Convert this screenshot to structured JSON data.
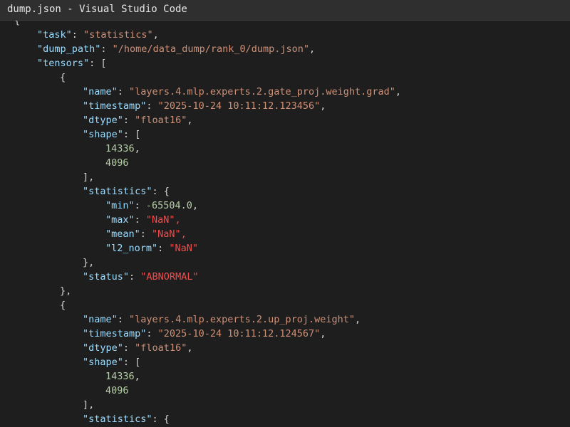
{
  "window": {
    "title": "dump.json - Visual Studio Code"
  },
  "colors": {
    "key": "#9cdcfe",
    "string": "#ce9178",
    "number": "#b5cea8",
    "error": "#f14c4c",
    "punctuation": "#d4d4d4",
    "background": "#1e1e1e"
  },
  "editor": {
    "lines": [
      {
        "indent": 1,
        "tokens": [
          {
            "t": "p",
            "v": "{"
          }
        ]
      },
      {
        "indent": 2,
        "tokens": [
          {
            "t": "k",
            "v": "\"task\""
          },
          {
            "t": "p",
            "v": ": "
          },
          {
            "t": "s",
            "v": "\"statistics\""
          },
          {
            "t": "p",
            "v": ","
          }
        ]
      },
      {
        "indent": 2,
        "tokens": [
          {
            "t": "k",
            "v": "\"dump_path\""
          },
          {
            "t": "p",
            "v": ": "
          },
          {
            "t": "s",
            "v": "\"/home/data_dump/rank_0/dump.json\""
          },
          {
            "t": "p",
            "v": ","
          }
        ]
      },
      {
        "indent": 2,
        "tokens": [
          {
            "t": "k",
            "v": "\"tensors\""
          },
          {
            "t": "p",
            "v": ": ["
          }
        ]
      },
      {
        "indent": 3,
        "tokens": [
          {
            "t": "p",
            "v": "{"
          }
        ]
      },
      {
        "indent": 4,
        "tokens": [
          {
            "t": "k",
            "v": "\"name\""
          },
          {
            "t": "p",
            "v": ": "
          },
          {
            "t": "s",
            "v": "\"layers.4.mlp.experts.2.gate_proj.weight.grad\""
          },
          {
            "t": "p",
            "v": ","
          }
        ]
      },
      {
        "indent": 4,
        "tokens": [
          {
            "t": "k",
            "v": "\"timestamp\""
          },
          {
            "t": "p",
            "v": ": "
          },
          {
            "t": "s",
            "v": "\"2025-10-24 10:11:12.123456\""
          },
          {
            "t": "p",
            "v": ","
          }
        ]
      },
      {
        "indent": 4,
        "tokens": [
          {
            "t": "k",
            "v": "\"dtype\""
          },
          {
            "t": "p",
            "v": ": "
          },
          {
            "t": "s",
            "v": "\"float16\""
          },
          {
            "t": "p",
            "v": ","
          }
        ]
      },
      {
        "indent": 4,
        "tokens": [
          {
            "t": "k",
            "v": "\"shape\""
          },
          {
            "t": "p",
            "v": ": ["
          }
        ]
      },
      {
        "indent": 5,
        "tokens": [
          {
            "t": "n",
            "v": "14336"
          },
          {
            "t": "p",
            "v": ","
          }
        ]
      },
      {
        "indent": 5,
        "tokens": [
          {
            "t": "n",
            "v": "4096"
          }
        ]
      },
      {
        "indent": 4,
        "tokens": [
          {
            "t": "p",
            "v": "],"
          }
        ]
      },
      {
        "indent": 4,
        "tokens": [
          {
            "t": "k",
            "v": "\"statistics\""
          },
          {
            "t": "p",
            "v": ": {"
          }
        ]
      },
      {
        "indent": 5,
        "tokens": [
          {
            "t": "k",
            "v": "\"min\""
          },
          {
            "t": "p",
            "v": ": "
          },
          {
            "t": "n",
            "v": "-65504.0"
          },
          {
            "t": "p",
            "v": ","
          }
        ]
      },
      {
        "indent": 5,
        "tokens": [
          {
            "t": "k",
            "v": "\"max\""
          },
          {
            "t": "p",
            "v": ": "
          },
          {
            "t": "bad",
            "v": "\"NaN\""
          },
          {
            "t": "bad",
            "v": ","
          }
        ]
      },
      {
        "indent": 5,
        "tokens": [
          {
            "t": "k",
            "v": "\"mean\""
          },
          {
            "t": "p",
            "v": ": "
          },
          {
            "t": "bad",
            "v": "\"NaN\""
          },
          {
            "t": "bad",
            "v": ","
          }
        ]
      },
      {
        "indent": 5,
        "tokens": [
          {
            "t": "k",
            "v": "\"l2_norm\""
          },
          {
            "t": "p",
            "v": ": "
          },
          {
            "t": "bad",
            "v": "\"NaN\""
          }
        ]
      },
      {
        "indent": 4,
        "tokens": [
          {
            "t": "p",
            "v": "},"
          }
        ]
      },
      {
        "indent": 4,
        "tokens": [
          {
            "t": "k",
            "v": "\"status\""
          },
          {
            "t": "p",
            "v": ": "
          },
          {
            "t": "bad",
            "v": "\"ABNORMAL\""
          }
        ]
      },
      {
        "indent": 3,
        "tokens": [
          {
            "t": "p",
            "v": "},"
          }
        ]
      },
      {
        "indent": 3,
        "tokens": [
          {
            "t": "p",
            "v": "{"
          }
        ]
      },
      {
        "indent": 4,
        "tokens": [
          {
            "t": "k",
            "v": "\"name\""
          },
          {
            "t": "p",
            "v": ": "
          },
          {
            "t": "s",
            "v": "\"layers.4.mlp.experts.2.up_proj.weight\""
          },
          {
            "t": "p",
            "v": ","
          }
        ]
      },
      {
        "indent": 4,
        "tokens": [
          {
            "t": "k",
            "v": "\"timestamp\""
          },
          {
            "t": "p",
            "v": ": "
          },
          {
            "t": "s",
            "v": "\"2025-10-24 10:11:12.124567\""
          },
          {
            "t": "p",
            "v": ","
          }
        ]
      },
      {
        "indent": 4,
        "tokens": [
          {
            "t": "k",
            "v": "\"dtype\""
          },
          {
            "t": "p",
            "v": ": "
          },
          {
            "t": "s",
            "v": "\"float16\""
          },
          {
            "t": "p",
            "v": ","
          }
        ]
      },
      {
        "indent": 4,
        "tokens": [
          {
            "t": "k",
            "v": "\"shape\""
          },
          {
            "t": "p",
            "v": ": ["
          }
        ]
      },
      {
        "indent": 5,
        "tokens": [
          {
            "t": "n",
            "v": "14336"
          },
          {
            "t": "p",
            "v": ","
          }
        ]
      },
      {
        "indent": 5,
        "tokens": [
          {
            "t": "n",
            "v": "4096"
          }
        ]
      },
      {
        "indent": 4,
        "tokens": [
          {
            "t": "p",
            "v": "],"
          }
        ]
      },
      {
        "indent": 4,
        "tokens": [
          {
            "t": "k",
            "v": "\"statistics\""
          },
          {
            "t": "p",
            "v": ": {"
          }
        ]
      }
    ]
  }
}
